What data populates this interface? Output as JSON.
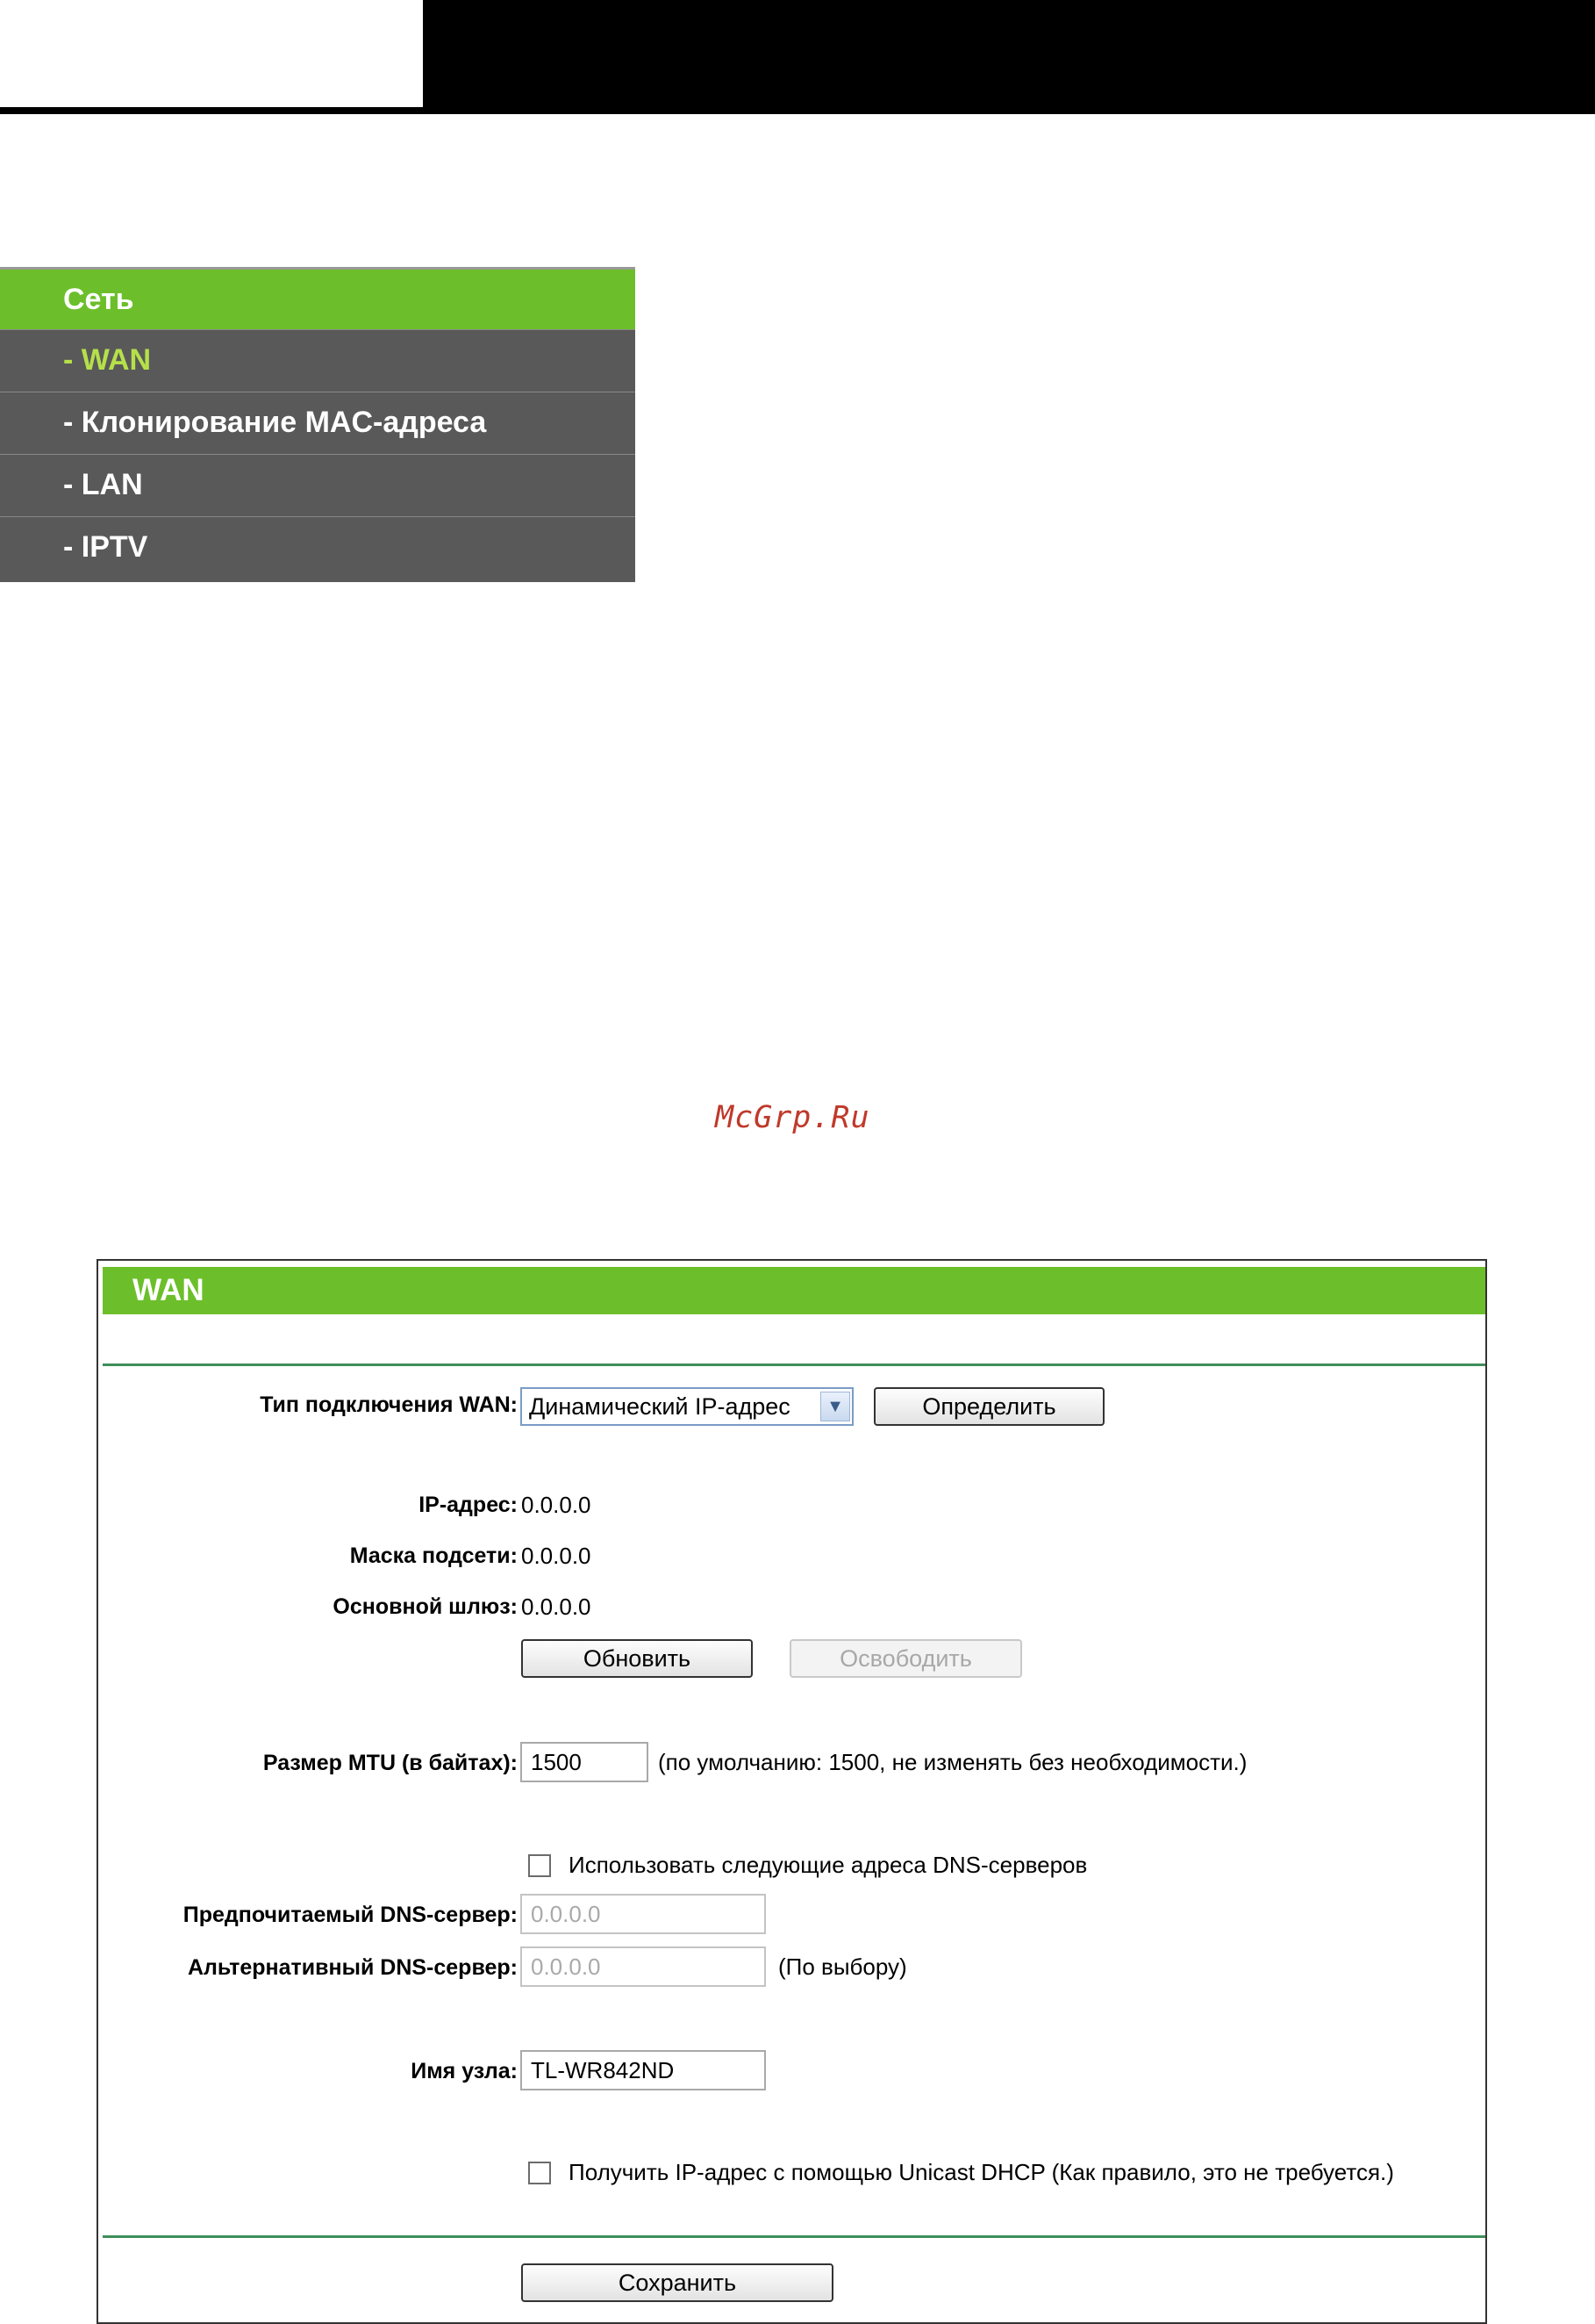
{
  "menu": {
    "items": [
      {
        "label": "Сеть"
      },
      {
        "label": "- WAN"
      },
      {
        "label": "- Клонирование MAC-адреса"
      },
      {
        "label": "- LAN"
      },
      {
        "label": "- IPTV"
      }
    ]
  },
  "watermark": "McGrp.Ru",
  "wan": {
    "title": "WAN",
    "connection_type_label": "Тип подключения WAN:",
    "connection_type_value": "Динамический IP-адрес",
    "detect_button": "Определить",
    "ip_label": "IP-адрес:",
    "ip_value": "0.0.0.0",
    "mask_label": "Маска подсети:",
    "mask_value": "0.0.0.0",
    "gateway_label": "Основной шлюз:",
    "gateway_value": "0.0.0.0",
    "renew_button": "Обновить",
    "release_button": "Освободить",
    "mtu_label": "Размер MTU (в байтах):",
    "mtu_value": "1500",
    "mtu_hint": "(по умолчанию: 1500, не изменять без необходимости.)",
    "use_dns_label": "Использовать следующие адреса DNS-серверов",
    "primary_dns_label": "Предпочитаемый DNS-сервер:",
    "primary_dns_value": "0.0.0.0",
    "secondary_dns_label": "Альтернативный DNS-сервер:",
    "secondary_dns_value": "0.0.0.0",
    "secondary_dns_hint": "(По выбору)",
    "hostname_label": "Имя узла:",
    "hostname_value": "TL-WR842ND",
    "unicast_label": "Получить IP-адрес с помощью Unicast DHCP (Как правило, это не требуется.)",
    "save_button": "Сохранить"
  }
}
